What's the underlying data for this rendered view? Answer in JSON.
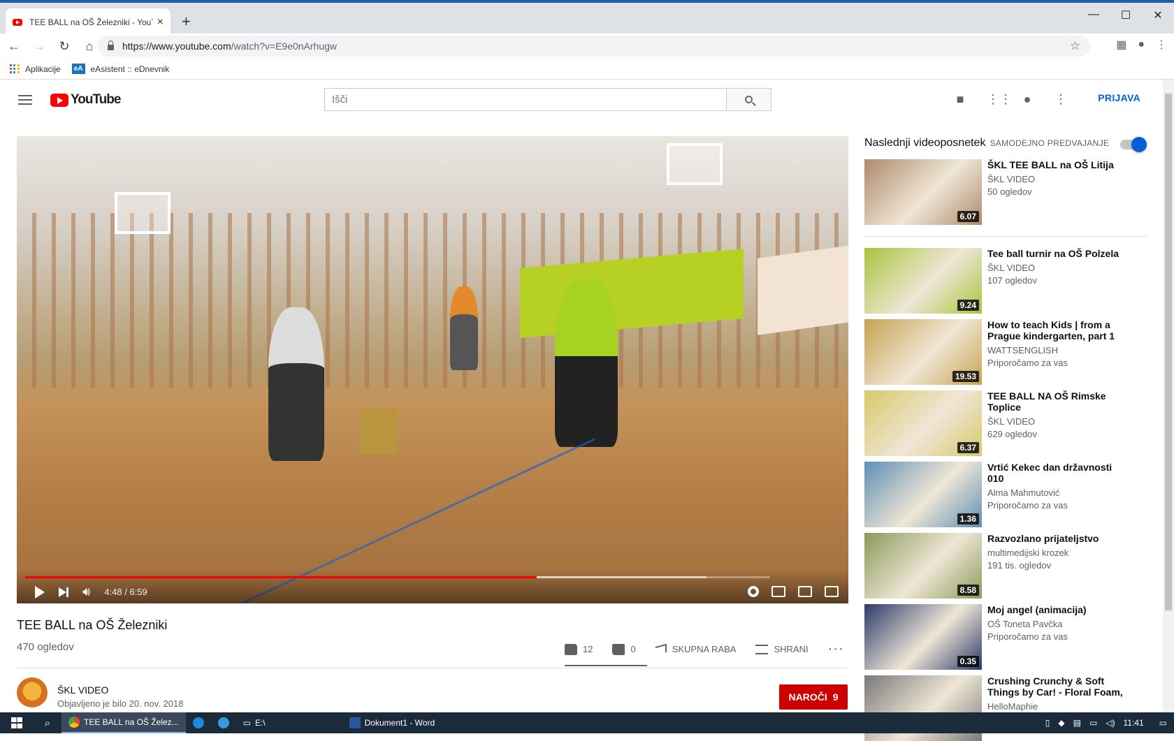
{
  "browser": {
    "tab_title": "TEE BALL na OŠ Železniki - YouTube",
    "url_host": "https://www.youtube.com",
    "url_path": "/watch?v=E9e0nArhugw",
    "bookmarks": [
      "Aplikacije",
      "eAsistent :: eDnevnik"
    ],
    "bookmark_ea_badge": "eA"
  },
  "header": {
    "logo_text": "YouTube",
    "search_placeholder": "Išči",
    "signin_label": "PRIJAVA"
  },
  "player": {
    "time_display": "4:48 / 6:59",
    "progress_fraction": 0.687,
    "buffered_fraction": 0.915
  },
  "video": {
    "title": "TEE BALL na OŠ Železniki",
    "views": "470 ogledov",
    "likes": "12",
    "dislikes": "0",
    "share_label": "SKUPNA RABA",
    "save_label": "SHRANI",
    "channel_name": "ŠKL VIDEO",
    "published": "Objavljeno je bilo 20. nov. 2018",
    "subscribe_label": "NAROČI",
    "subscriber_count": "9"
  },
  "sidebar": {
    "next_label": "Naslednji videoposnetek",
    "autoplay_label": "SAMODEJNO PREDVAJANJE",
    "items": [
      {
        "title": "ŠKL TEE BALL na OŠ Litija",
        "channel": "ŠKL VIDEO",
        "meta": "50 ogledov",
        "duration": "6.07",
        "color": "#b08a6a"
      },
      {
        "title": "Tee ball turnir na OŠ Polzela",
        "channel": "ŠKL VIDEO",
        "meta": "107 ogledov",
        "duration": "9.24",
        "color": "#a7c53c"
      },
      {
        "title": "How to teach Kids | from a Prague kindergarten, part 1 |...",
        "channel": "WATTSENGLISH",
        "meta": "Priporočamo za vas",
        "duration": "19.53",
        "color": "#c9a24f"
      },
      {
        "title": "TEE BALL NA OŠ Rimske Toplice",
        "channel": "ŠKL VIDEO",
        "meta": "629 ogledov",
        "duration": "6.37",
        "color": "#d8c96a"
      },
      {
        "title": "Vrtić Kekec dan državnosti 010",
        "channel": "Alma Mahmutović",
        "meta": "Priporočamo za vas",
        "duration": "1.36",
        "color": "#5f8fb5"
      },
      {
        "title": "Razvozlano prijateljstvo",
        "channel": "multimedijski krozek",
        "meta": "191 tis. ogledov",
        "duration": "8.58",
        "color": "#8a9a5a"
      },
      {
        "title": "Moj angel (animacija)",
        "channel": "OŠ Toneta Pavčka",
        "meta": "Priporočamo za vas",
        "duration": "0.35",
        "color": "#2c3a6a"
      },
      {
        "title": "Crushing Crunchy & Soft Things by Car! - Floral Foam, Squishy,...",
        "channel": "HelloMaphie",
        "meta": "",
        "duration": "",
        "color": "#7a7a7a"
      }
    ]
  },
  "taskbar": {
    "tasks": [
      "TEE BALL na OŠ Želez...",
      "E:\\",
      "Dokument1 - Word"
    ],
    "clock": "11:41"
  }
}
